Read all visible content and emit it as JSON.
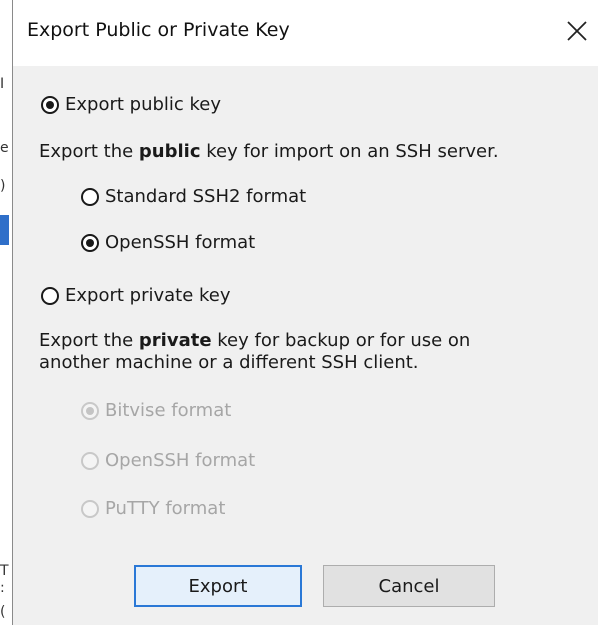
{
  "background_window": {
    "strip_chars": [
      "I",
      "e",
      ")",
      "T",
      ":",
      "("
    ]
  },
  "dialog": {
    "title": "Export Public or Private Key",
    "close_glyph": "close-icon",
    "public_section": {
      "option_label": "Export public key",
      "selected": true,
      "description_before": "Export the ",
      "description_bold": "public",
      "description_after": " key for import on an SSH server.",
      "formats": [
        {
          "label": "Standard SSH2 format",
          "selected": false,
          "enabled": true
        },
        {
          "label": "OpenSSH format",
          "selected": true,
          "enabled": true
        }
      ]
    },
    "private_section": {
      "option_label": "Export private key",
      "selected": false,
      "description_before": "Export the ",
      "description_bold": "private",
      "description_after": " key for backup or for use on",
      "description_line2": "another machine or a different SSH client.",
      "formats": [
        {
          "label": "Bitvise format",
          "selected": true,
          "enabled": false
        },
        {
          "label": "OpenSSH format",
          "selected": false,
          "enabled": false
        },
        {
          "label": "PuTTY format",
          "selected": false,
          "enabled": false
        }
      ]
    },
    "buttons": {
      "export_label": "Export",
      "cancel_label": "Cancel"
    },
    "colors": {
      "dialog_bg": "#f0f0f0",
      "titlebar_bg": "#ffffff",
      "default_button_border": "#2a78d6",
      "disabled_text": "#a6a6a6"
    }
  }
}
